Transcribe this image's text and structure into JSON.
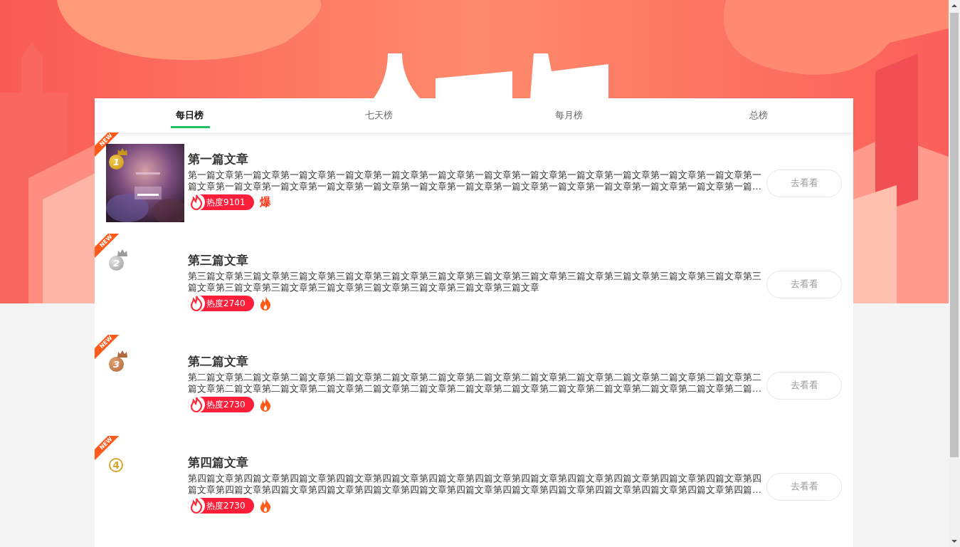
{
  "tabs": [
    {
      "label": "每日榜",
      "selected": true
    },
    {
      "label": "七天榜",
      "selected": false
    },
    {
      "label": "每月榜",
      "selected": false
    },
    {
      "label": "总榜",
      "selected": false
    }
  ],
  "articles": [
    {
      "badge": "NEW",
      "rank": "1",
      "kind": "gold",
      "title": "第一篇文章",
      "description": "第一篇文章第一篇文章第一篇文章第一篇文章第一篇文章第一篇文章第一篇文章第一篇文章第一篇文章第一篇文章第一篇文章第一篇文章第一篇文章第一篇文章第一篇文章第一篇文章第一篇文章第一篇文章第一篇文章第一篇文章第一篇文章第一篇文章第一篇文章第一篇文章第一篇…",
      "heat": "热度9101",
      "burst": "爆",
      "button": "去看看"
    },
    {
      "badge": "NEW",
      "rank": "2",
      "kind": "silver",
      "title": "第三篇文章",
      "description": "第三篇文章第三篇文章第三篇文章第三篇文章第三篇文章第三篇文章第三篇文章第三篇文章第三篇文章第三篇文章第三篇文章第三篇文章第三篇文章第三篇文章第三篇文章第三篇文章第三篇文章第三篇文章第三篇文章第三篇文章",
      "heat": "热度2740",
      "button": "去看看"
    },
    {
      "badge": "NEW",
      "rank": "3",
      "kind": "bronze",
      "title": "第二篇文章",
      "description": "第二篇文章第二篇文章第二篇文章第二篇文章第二篇文章第二篇文章第二篇文章第二篇文章第二篇文章第二篇文章第二篇文章第二篇文章第二篇文章第二篇文章第二篇文章第二篇文章第二篇文章第二篇文章第二篇文章第二篇文章第二篇文章第二篇文章第二篇文章第二篇文章第二篇…",
      "heat": "热度2730",
      "button": "去看看"
    },
    {
      "badge": "NEW",
      "rank": "4",
      "kind": "plain",
      "title": "第四篇文章",
      "description": "第四篇文章第四篇文章第四篇文章第四篇文章第四篇文章第四篇文章第四篇文章第四篇文章第四篇文章第四篇文章第四篇文章第四篇文章第四篇文章第四篇文章第四篇文章第四篇文章第四篇文章第四篇文章第四篇文章第四篇文章第四篇文章第四篇文章第四篇文章第四篇文章第四篇…",
      "heat": "热度2730",
      "button": "去看看"
    }
  ]
}
